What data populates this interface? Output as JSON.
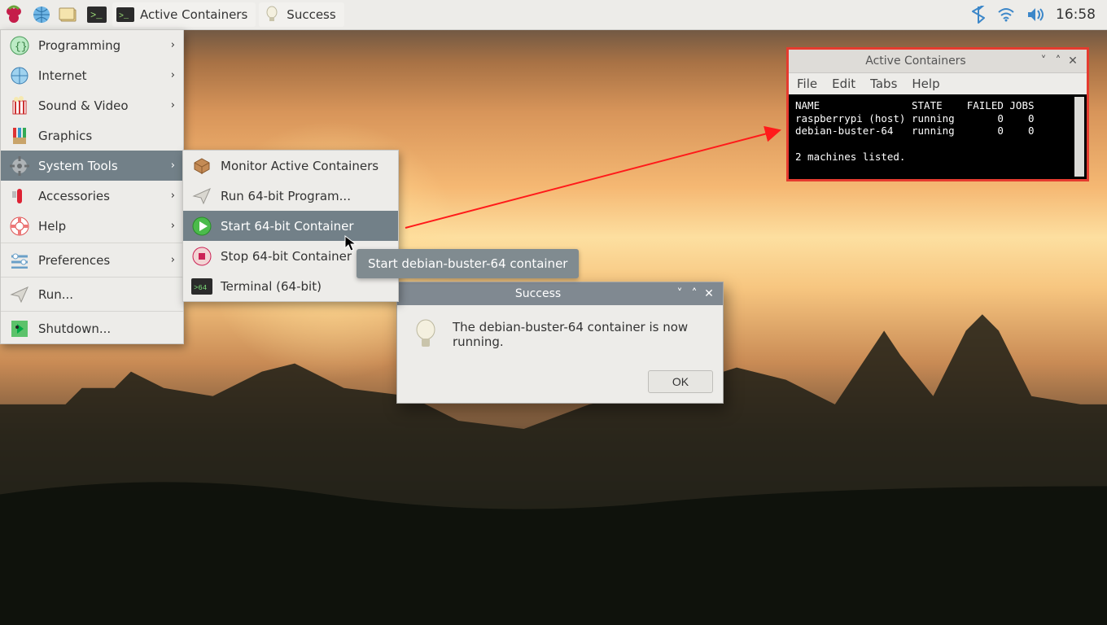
{
  "panel": {
    "task1": "Active Containers",
    "task2": "Success",
    "clock": "16:58"
  },
  "menu_main": {
    "items": [
      {
        "label": "Programming",
        "sub": true
      },
      {
        "label": "Internet",
        "sub": true
      },
      {
        "label": "Sound & Video",
        "sub": true
      },
      {
        "label": "Graphics",
        "sub": false
      },
      {
        "label": "System Tools",
        "sub": true,
        "sel": true
      },
      {
        "label": "Accessories",
        "sub": true
      },
      {
        "label": "Help",
        "sub": true
      },
      {
        "label": "Preferences",
        "sub": true
      },
      {
        "label": "Run...",
        "sub": false
      },
      {
        "label": "Shutdown...",
        "sub": false
      }
    ]
  },
  "menu_sub": {
    "items": [
      {
        "label": "Monitor Active Containers"
      },
      {
        "label": "Run 64-bit Program..."
      },
      {
        "label": "Start 64-bit Container",
        "sel": true
      },
      {
        "label": "Stop 64-bit Container"
      },
      {
        "label": "Terminal (64-bit)"
      }
    ]
  },
  "tooltip": "Start debian-buster-64 container",
  "dialog_success": {
    "title": "Success",
    "message": "The debian-buster-64 container is now running.",
    "ok": "OK"
  },
  "terminal": {
    "title": "Active Containers",
    "menus": [
      "File",
      "Edit",
      "Tabs",
      "Help"
    ],
    "content": "NAME               STATE    FAILED JOBS\nraspberrypi (host) running       0    0\ndebian-buster-64   running       0    0\n\n2 machines listed."
  }
}
